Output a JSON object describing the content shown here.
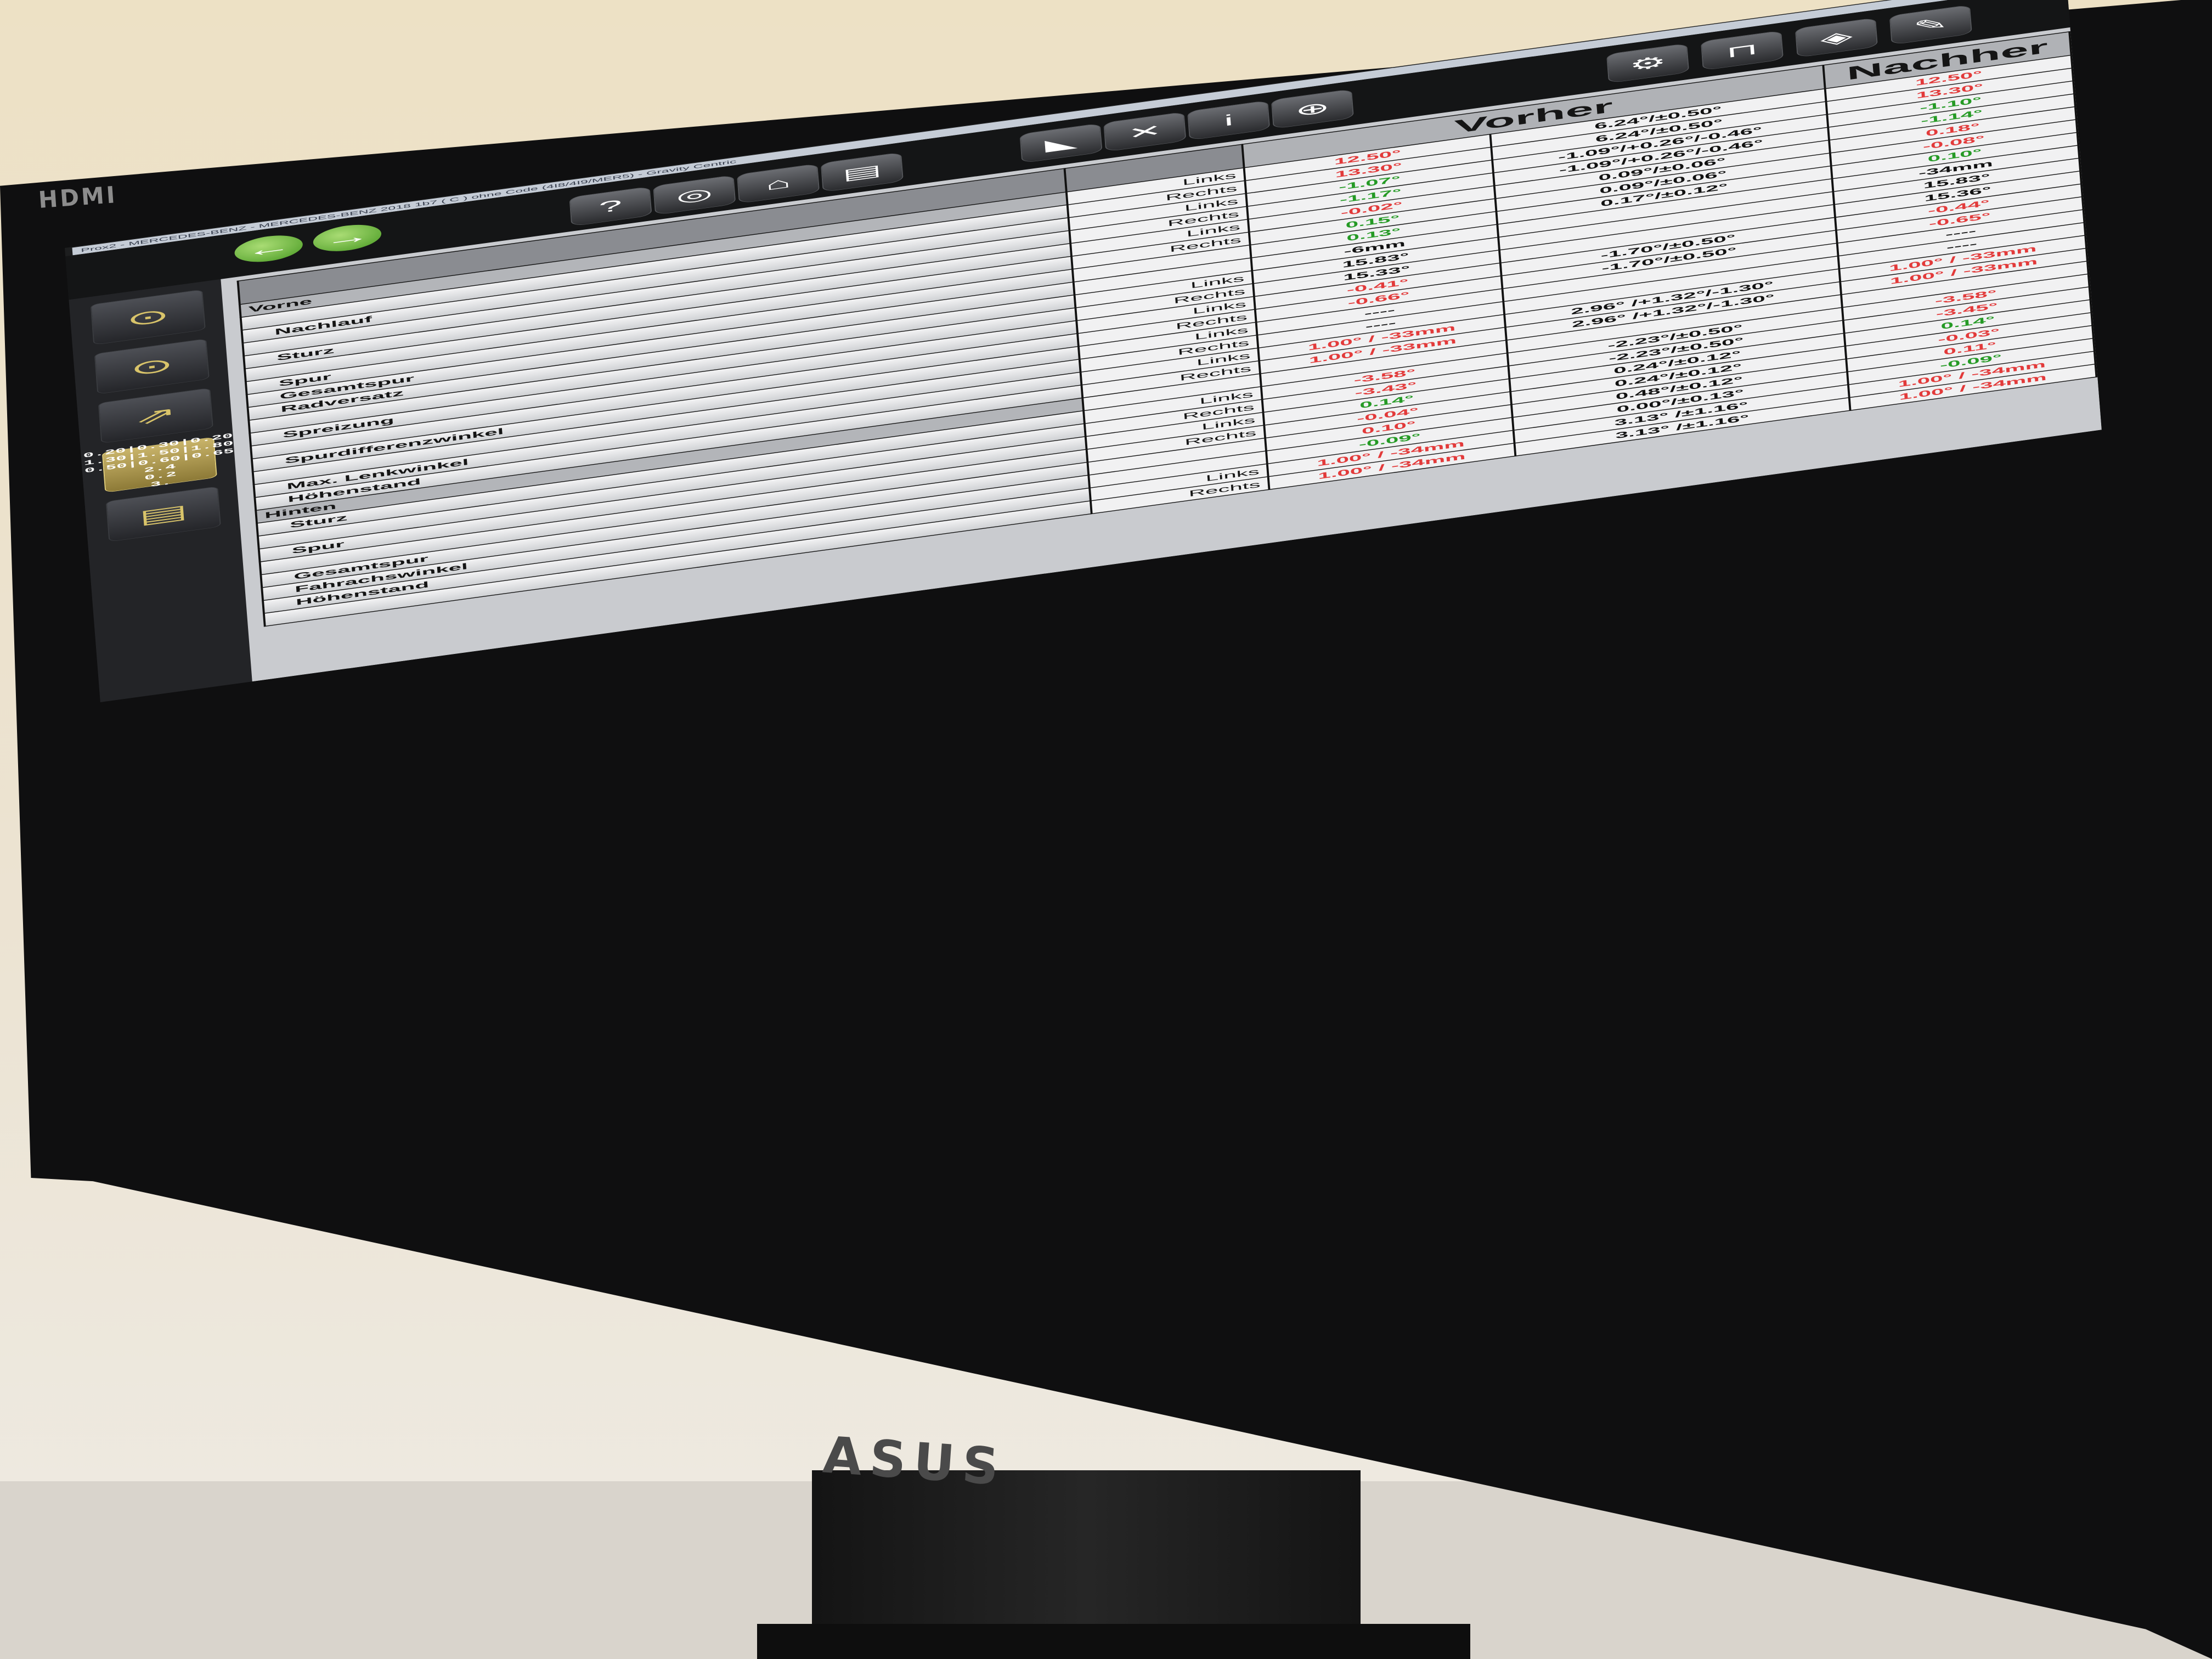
{
  "window_title": "Prox2 - MERCEDES-BENZ - MERCEDES-BENZ 2018 1b7 ( C ) ohne Code (4I8/4I9/MER5)  - Gravity Centric",
  "monitor": {
    "input_label": "HDMI",
    "brand": "ASUS"
  },
  "toolbar": {
    "back_icon": "arrow-left-icon",
    "forward_icon": "arrow-right-icon",
    "icons": [
      "help-icon",
      "wheel-icon",
      "home-icon",
      "printer-icon",
      "measure-icon",
      "tools-icon",
      "info-icon",
      "zoom-icon",
      "settings-icon",
      "lock-icon",
      "vehicle-icon",
      "service-icon"
    ]
  },
  "sidebar": {
    "mini_table": [
      "0.20|0.30|0.20",
      "1.30|1.50|1.80",
      "0.50|0.60|0.65",
      "2.4",
      "0.2",
      "3."
    ]
  },
  "headers": {
    "vorher": "Vorher",
    "nachher": "Nachher"
  },
  "rows": [
    {
      "label": "Vorne",
      "group": true,
      "side": "Links",
      "vorher": "12.50°",
      "vc": "red",
      "tol": "6.24°/±0.50°",
      "nachher": "12.50°",
      "nc": "red"
    },
    {
      "label": "",
      "side": "Rechts",
      "vorher": "13.30°",
      "vc": "red",
      "tol": "6.24°/±0.50°",
      "nachher": "13.30°",
      "nc": "red"
    },
    {
      "label": "Nachlauf",
      "side": "Links",
      "vorher": "-1.07°",
      "vc": "green",
      "tol": "-1.09°/+0.26°/-0.46°",
      "nachher": "-1.10°",
      "nc": "green"
    },
    {
      "label": "",
      "side": "Rechts",
      "vorher": "-1.17°",
      "vc": "green",
      "tol": "-1.09°/+0.26°/-0.46°",
      "nachher": "-1.14°",
      "nc": "green"
    },
    {
      "label": "Sturz",
      "side": "Links",
      "vorher": "-0.02°",
      "vc": "red",
      "tol": "0.09°/±0.06°",
      "nachher": "0.18°",
      "nc": "red"
    },
    {
      "label": "",
      "side": "Rechts",
      "vorher": "0.15°",
      "vc": "green",
      "tol": "0.09°/±0.06°",
      "nachher": "-0.08°",
      "nc": "red"
    },
    {
      "label": "Spur",
      "side": "",
      "vorher": "0.13°",
      "vc": "green",
      "tol": "0.17°/±0.12°",
      "nachher": "0.10°",
      "nc": "green"
    },
    {
      "label": "Gesamtspur",
      "side": "",
      "vorher": "-6mm",
      "vc": "blk",
      "tol": "",
      "nachher": "-34mm",
      "nc": "blk"
    },
    {
      "label": "Radversatz",
      "side": "Links",
      "vorher": "15.83°",
      "vc": "blk",
      "tol": "",
      "nachher": "15.83°",
      "nc": "blk"
    },
    {
      "label": "",
      "side": "Rechts",
      "vorher": "15.33°",
      "vc": "blk",
      "tol": "",
      "nachher": "15.36°",
      "nc": "blk"
    },
    {
      "label": "Spreizung",
      "side": "Links",
      "vorher": "-0.41°",
      "vc": "red",
      "tol": "-1.70°/±0.50°",
      "nachher": "-0.44°",
      "nc": "red"
    },
    {
      "label": "",
      "side": "Rechts",
      "vorher": "-0.66°",
      "vc": "red",
      "tol": "-1.70°/±0.50°",
      "nachher": "-0.65°",
      "nc": "red"
    },
    {
      "label": "Spurdifferenzwinkel",
      "side": "Links",
      "vorher": "----",
      "vc": "blk",
      "tol": "",
      "nachher": "----",
      "nc": "blk"
    },
    {
      "label": "",
      "side": "Rechts",
      "vorher": "----",
      "vc": "blk",
      "tol": "",
      "nachher": "----",
      "nc": "blk"
    },
    {
      "label": "Max. Lenkwinkel",
      "side": "Links",
      "vorher": "1.00° / -33mm",
      "vc": "red",
      "tol": "2.96° /+1.32°/-1.30°",
      "nachher": "1.00° / -33mm",
      "nc": "red"
    },
    {
      "label": "Höhenstand",
      "side": "Rechts",
      "vorher": "1.00° / -33mm",
      "vc": "red",
      "tol": "2.96° /+1.32°/-1.30°",
      "nachher": "1.00° / -33mm",
      "nc": "red"
    },
    {
      "label": "Hinten",
      "group": true,
      "side": "",
      "vorher": "",
      "vc": "blk",
      "tol": "",
      "nachher": "",
      "nc": "blk"
    },
    {
      "label": "Sturz",
      "side": "Links",
      "vorher": "-3.58°",
      "vc": "red",
      "tol": "-2.23°/±0.50°",
      "nachher": "-3.58°",
      "nc": "red"
    },
    {
      "label": "",
      "side": "Rechts",
      "vorher": "-3.43°",
      "vc": "red",
      "tol": "-2.23°/±0.50°",
      "nachher": "-3.45°",
      "nc": "red"
    },
    {
      "label": "Spur",
      "side": "Links",
      "vorher": "0.14°",
      "vc": "green",
      "tol": "0.24°/±0.12°",
      "nachher": "0.14°",
      "nc": "green"
    },
    {
      "label": "",
      "side": "Rechts",
      "vorher": "-0.04°",
      "vc": "red",
      "tol": "0.24°/±0.12°",
      "nachher": "-0.03°",
      "nc": "red"
    },
    {
      "label": "Gesamtspur",
      "side": "",
      "vorher": "0.10°",
      "vc": "red",
      "tol": "0.48°/±0.12°",
      "nachher": "0.11°",
      "nc": "red"
    },
    {
      "label": "Fahrachswinkel",
      "side": "",
      "vorher": "-0.09°",
      "vc": "green",
      "tol": "0.00°/±0.13°",
      "nachher": "-0.09°",
      "nc": "green"
    },
    {
      "label": "Höhenstand",
      "side": "Links",
      "vorher": "1.00° / -34mm",
      "vc": "red",
      "tol": "3.13° /±1.16°",
      "nachher": "1.00° / -34mm",
      "nc": "red"
    },
    {
      "label": "",
      "side": "Rechts",
      "vorher": "1.00° / -34mm",
      "vc": "red",
      "tol": "3.13° /±1.16°",
      "nachher": "1.00° / -34mm",
      "nc": "red"
    }
  ]
}
